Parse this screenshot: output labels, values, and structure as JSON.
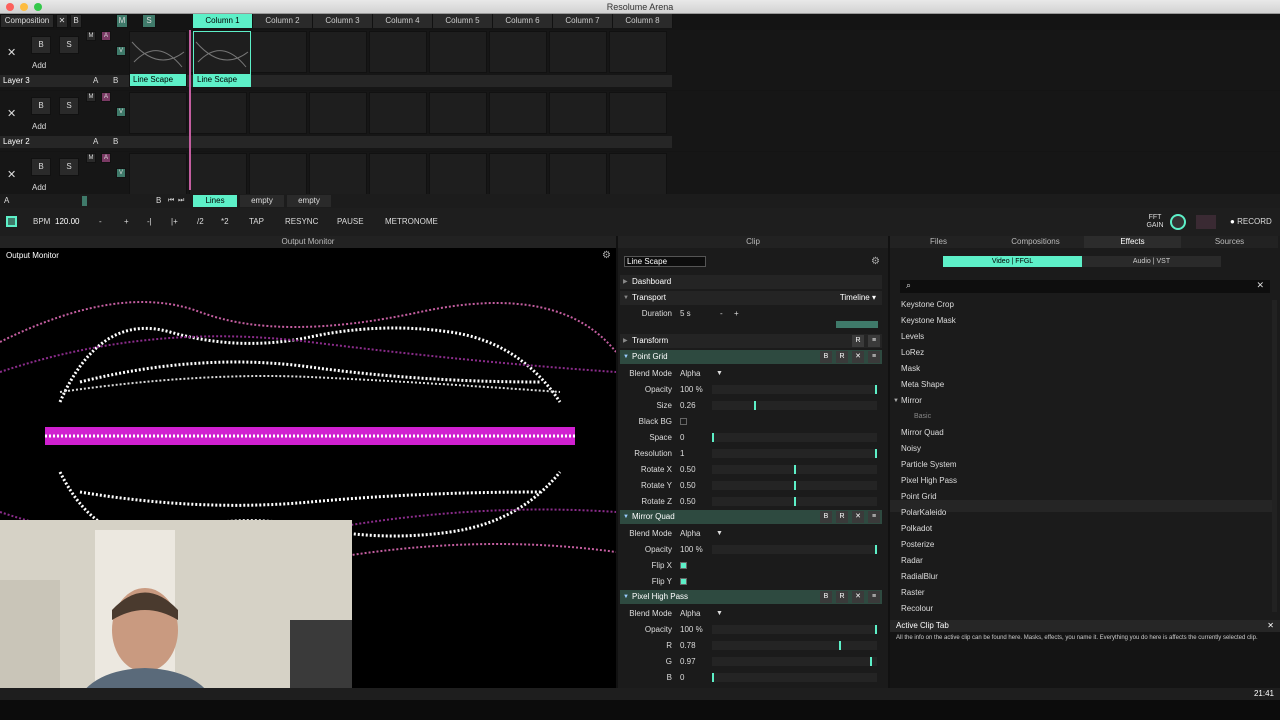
{
  "app_title": "Resolume Arena",
  "composition": {
    "label": "Composition",
    "close": "✕",
    "b": "B",
    "m": "M",
    "s": "S",
    "columns": [
      "Column 1",
      "Column 2",
      "Column 3",
      "Column 4",
      "Column 5",
      "Column 6",
      "Column 7",
      "Column 8"
    ]
  },
  "layers": [
    {
      "name": "Layer 3",
      "b": "B",
      "s": "S",
      "x": "✕",
      "add": "Add",
      "m": "M",
      "a": "A",
      "v": "V",
      "ab_a": "A",
      "ab_b": "B",
      "clips": [
        "Line Scape",
        "Line Scape"
      ]
    },
    {
      "name": "Layer 2",
      "b": "B",
      "s": "S",
      "x": "✕",
      "add": "Add",
      "m": "M",
      "a": "A",
      "v": "V",
      "ab_a": "A",
      "ab_b": "B",
      "clips": []
    },
    {
      "name": "",
      "b": "B",
      "s": "S",
      "x": "✕",
      "add": "Add",
      "m": "M",
      "a": "A",
      "v": "V",
      "ab_a": "A",
      "ab_b": "B",
      "clips": []
    }
  ],
  "deck": {
    "a": "A",
    "b": "B",
    "tabs": [
      "Lines",
      "empty",
      "empty"
    ]
  },
  "transport": {
    "bpm_label": "BPM",
    "bpm": "120.00",
    "minus": "-",
    "plus": "+",
    "prev": "-|",
    "next": "|+",
    "half": "/2",
    "double": "*2",
    "tap": "TAP",
    "resync": "RESYNC",
    "pause": "PAUSE",
    "metronome": "METRONOME",
    "fft": "FFT",
    "gain": "GAIN",
    "record": "RECORD"
  },
  "output": {
    "header": "Output Monitor",
    "title": "Output Monitor"
  },
  "clip": {
    "header": "Clip",
    "name": "Line Scape",
    "dashboard": "Dashboard",
    "transport": "Transport",
    "timeline": "Timeline",
    "duration_label": "Duration",
    "duration": "5 s",
    "dminus": "-",
    "dplus": "+",
    "transform": "Transform",
    "r": "R",
    "b": "B",
    "x": "✕",
    "menu": "≡",
    "effects": [
      {
        "name": "Point Grid",
        "params": [
          {
            "label": "Blend Mode",
            "value": "Alpha",
            "type": "dropdown"
          },
          {
            "label": "Opacity",
            "value": "100 %",
            "type": "slider",
            "level": 1.0
          },
          {
            "label": "Size",
            "value": "0.26",
            "type": "slider",
            "level": 0.26
          },
          {
            "label": "Black BG",
            "value": "",
            "type": "check",
            "checked": false
          },
          {
            "label": "Space",
            "value": "0",
            "type": "slider",
            "level": 0.0
          },
          {
            "label": "Resolution",
            "value": "1",
            "type": "slider",
            "level": 1.0
          },
          {
            "label": "Rotate X",
            "value": "0.50",
            "type": "slider",
            "level": 0.5
          },
          {
            "label": "Rotate Y",
            "value": "0.50",
            "type": "slider",
            "level": 0.5
          },
          {
            "label": "Rotate Z",
            "value": "0.50",
            "type": "slider",
            "level": 0.5
          }
        ]
      },
      {
        "name": "Mirror Quad",
        "params": [
          {
            "label": "Blend Mode",
            "value": "Alpha",
            "type": "dropdown"
          },
          {
            "label": "Opacity",
            "value": "100 %",
            "type": "slider",
            "level": 1.0
          },
          {
            "label": "Flip X",
            "value": "",
            "type": "check",
            "checked": true
          },
          {
            "label": "Flip Y",
            "value": "",
            "type": "check",
            "checked": true
          }
        ]
      },
      {
        "name": "Pixel High Pass",
        "params": [
          {
            "label": "Blend Mode",
            "value": "Alpha",
            "type": "dropdown"
          },
          {
            "label": "Opacity",
            "value": "100 %",
            "type": "slider",
            "level": 1.0
          },
          {
            "label": "R",
            "value": "0.78",
            "type": "slider",
            "level": 0.78
          },
          {
            "label": "G",
            "value": "0.97",
            "type": "slider",
            "level": 0.97
          },
          {
            "label": "B",
            "value": "0",
            "type": "slider",
            "level": 0.0
          }
        ]
      }
    ]
  },
  "browser": {
    "tabs": [
      "Files",
      "Compositions",
      "Effects",
      "Sources"
    ],
    "sub_tabs": [
      "Video | FFGL",
      "Audio | VST"
    ],
    "clear": "✕",
    "items": [
      "Keystone Crop",
      "Keystone Mask",
      "Levels",
      "LoRez",
      "Mask",
      "Meta Shape",
      "Mirror",
      "Basic",
      "Mirror Quad",
      "Noisy",
      "Particle System",
      "Pixel High Pass",
      "Point Grid",
      "PolarKaleido",
      "Polkadot",
      "Posterize",
      "Radar",
      "RadialBlur",
      "Raster",
      "Recolour"
    ]
  },
  "help": {
    "title": "Active Clip Tab",
    "close": "✕",
    "text": "All the info on the active clip can be found here. Masks, effects, you name it. Everything you do here is affects the currently selected clip."
  },
  "status": {
    "time": "21:41"
  },
  "colors": {
    "accent": "#5df0c8",
    "pink": "#c45ea0",
    "panel": "#1b1b1b"
  }
}
